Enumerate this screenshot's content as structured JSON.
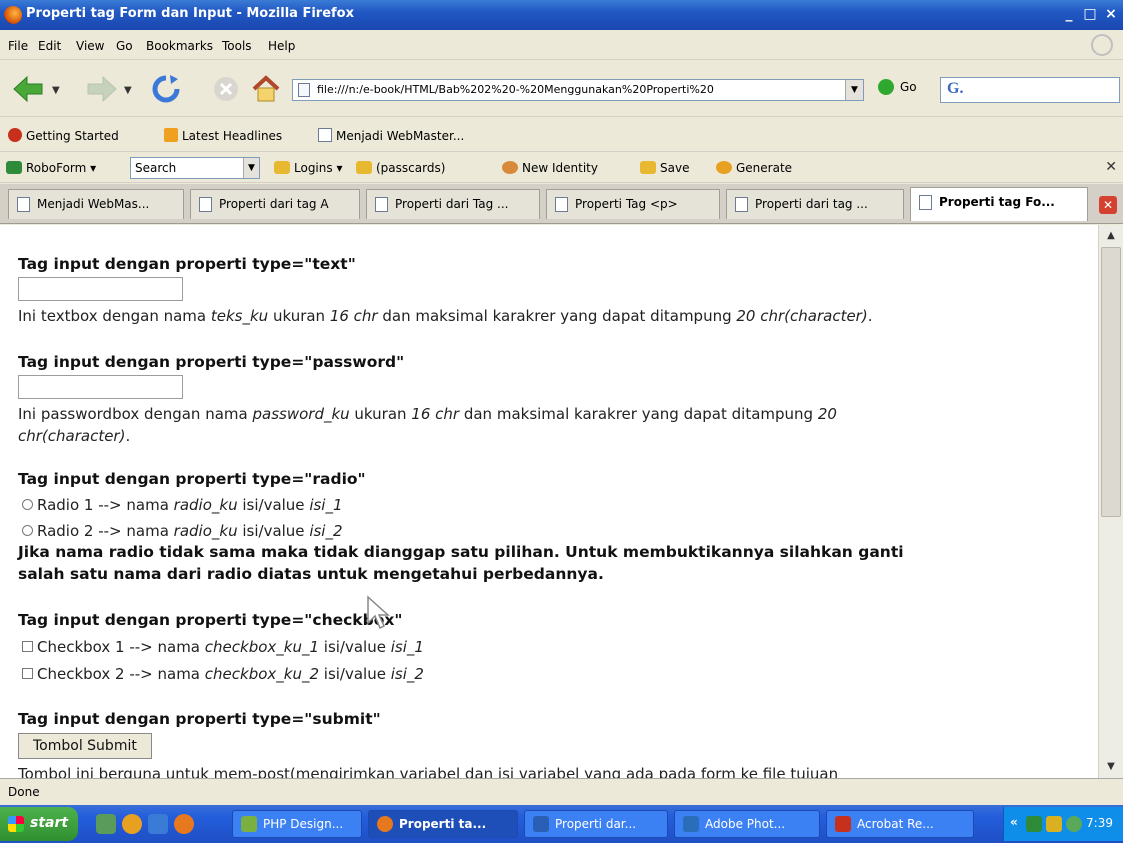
{
  "window": {
    "title": "Properti tag Form dan Input - Mozilla Firefox",
    "controls": [
      "_",
      "□",
      "×"
    ]
  },
  "menu": [
    "File",
    "Edit",
    "View",
    "Go",
    "Bookmarks",
    "Tools",
    "Help"
  ],
  "nav": {
    "url": "file:///n:/e-book/HTML/Bab%202%20-%20Menggunakan%20Properti%20",
    "go_label": "Go",
    "search_logo": "G."
  },
  "bookmarks": [
    {
      "label": "Getting Started",
      "icon": "getting-started-icon",
      "color": "#c8301e"
    },
    {
      "label": "Latest Headlines",
      "icon": "rss-icon",
      "color": "#f0a020"
    },
    {
      "label": "Menjadi WebMaster...",
      "icon": "page-icon",
      "color": "#6d7c92"
    }
  ],
  "roboform": {
    "brand": "RoboForm",
    "search_value": "Search",
    "logins": "Logins",
    "passcards": "(passcards)",
    "new_identity": "New Identity",
    "save": "Save",
    "generate": "Generate"
  },
  "tabs": [
    {
      "label": "Menjadi WebMas...",
      "active": false
    },
    {
      "label": "Properti dari tag A",
      "active": false
    },
    {
      "label": "Properti dari Tag ...",
      "active": false
    },
    {
      "label": "Properti Tag <p>",
      "active": false
    },
    {
      "label": "Properti dari tag ...",
      "active": false
    },
    {
      "label": "Properti tag Fo...",
      "active": true
    }
  ],
  "content": {
    "h_text": "Tag input dengan properti type=\"text\"",
    "p_text_a": "Ini textbox dengan nama ",
    "p_text_b": "teks_ku",
    "p_text_c": " ukuran ",
    "p_text_d": "16 chr",
    "p_text_e": " dan maksimal karakrer yang dapat ditampung ",
    "p_text_f": "20 chr(character)",
    "p_text_g": ".",
    "h_password": "Tag input dengan properti type=\"password\"",
    "p_pw1_a": "Ini passwordbox dengan nama ",
    "p_pw1_b": "password_ku",
    "p_pw1_c": " ukuran ",
    "p_pw1_d": "16 chr",
    "p_pw1_e": " dan maksimal karakrer yang dapat ditampung ",
    "p_pw1_f": "20",
    "p_pw2_a": "chr(character)",
    "p_pw2_b": ".",
    "h_radio": "Tag input dengan properti type=\"radio\"",
    "radio1_a": "Radio 1 --> nama ",
    "radio1_b": "radio_ku",
    "radio1_c": " isi/value ",
    "radio1_d": "isi_1",
    "radio2_a": "Radio 2 --> nama ",
    "radio2_b": "radio_ku",
    "radio2_c": " isi/value ",
    "radio2_d": "isi_2",
    "radio_note1": "Jika nama radio tidak sama maka tidak dianggap satu pilihan. Untuk membuktikannya silahkan ganti",
    "radio_note2": "salah satu nama dari radio diatas untuk mengetahui perbedannya.",
    "h_checkbox": "Tag input dengan properti type=\"checkbox\"",
    "cb1_a": "Checkbox 1 --> nama ",
    "cb1_b": "checkbox_ku_1",
    "cb1_c": " isi/value ",
    "cb1_d": "isi_1",
    "cb2_a": "Checkbox 2 --> nama ",
    "cb2_b": "checkbox_ku_2",
    "cb2_c": " isi/value ",
    "cb2_d": "isi_2",
    "h_submit": "Tag input dengan properti type=\"submit\"",
    "submit_label": "Tombol Submit",
    "submit_note": "Tombol ini berguna untuk mem-post(mengirimkan variabel dan isi variabel yang ada pada form ke file tujuan"
  },
  "status": "Done",
  "taskbar": {
    "start": "start",
    "tasks": [
      {
        "label": "PHP Design...",
        "active": false,
        "icon_color": "#7ab040"
      },
      {
        "label": "Properti ta...",
        "active": true,
        "icon_color": "#e8781e"
      },
      {
        "label": "Properti dar...",
        "active": false,
        "icon_color": "#2b5fb5"
      },
      {
        "label": "Adobe Phot...",
        "active": false,
        "icon_color": "#2a6db8"
      },
      {
        "label": "Acrobat Re...",
        "active": false,
        "icon_color": "#c8301e"
      }
    ],
    "clock": "7:39"
  }
}
